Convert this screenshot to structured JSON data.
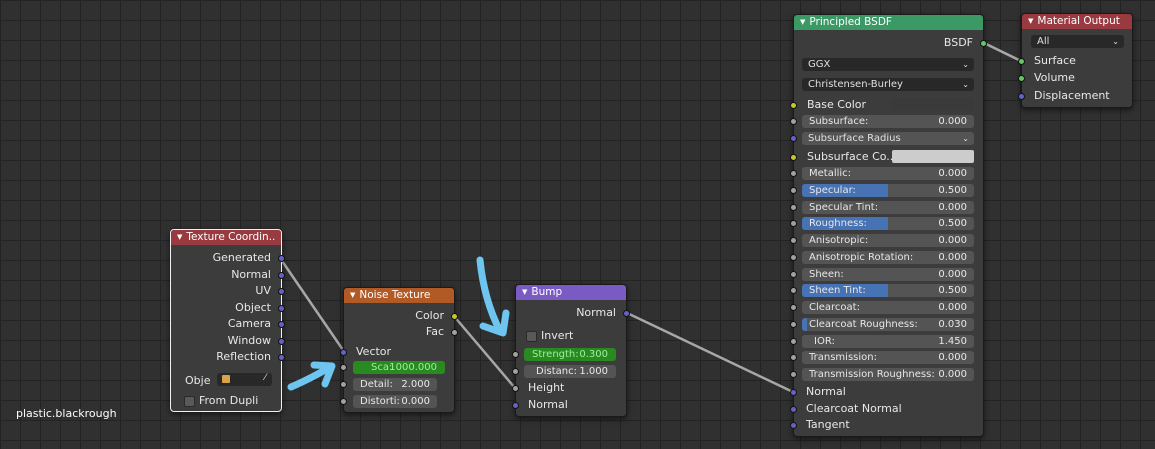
{
  "caption": "plastic.blackrough",
  "colors": {
    "header_red": "#983a3f",
    "header_orange": "#b25a26",
    "header_purple": "#7a5bc4",
    "header_green": "#3a9965",
    "socket_vector": "#6363c7",
    "socket_color": "#c7c729",
    "socket_float": "#a1a1a1",
    "socket_shader": "#63c763",
    "field_blue": "#4772b3",
    "field_green": "#2a8a22",
    "arrow": "#6ec6f0"
  },
  "texture_coordinate": {
    "title": "Texture Coordin..",
    "outputs": [
      "Generated",
      "Normal",
      "UV",
      "Object",
      "Camera",
      "Window",
      "Reflection"
    ],
    "object_label": "Obje",
    "from_dupli": "From Dupli"
  },
  "noise_texture": {
    "title": "Noise Texture",
    "outputs": [
      "Color",
      "Fac"
    ],
    "vector": "Vector",
    "scale": {
      "label": "Sca:",
      "value": "1000.000"
    },
    "detail": {
      "label": "Detail:",
      "value": "2.000"
    },
    "distortion": {
      "label": "Distorti:",
      "value": "0.000"
    }
  },
  "bump": {
    "title": "Bump",
    "output": "Normal",
    "invert": "Invert",
    "strength": {
      "label": "Strength:",
      "value": "0.300"
    },
    "distance": {
      "label": "Distanc:",
      "value": "1.000"
    },
    "height": "Height",
    "normal_in": "Normal"
  },
  "principled": {
    "title": "Principled BSDF",
    "output": "BSDF",
    "distribution": "GGX",
    "subsurface_method": "Christensen-Burley",
    "base_color": "Base Color",
    "subsurface": {
      "label": "Subsurface:",
      "value": "0.000"
    },
    "subsurface_radius": "Subsurface Radius",
    "subsurface_color": "Subsurface Co..",
    "fields": [
      {
        "label": "Metallic:",
        "value": "0.000",
        "fill": 0.0
      },
      {
        "label": "Specular:",
        "value": "0.500",
        "fill": 0.5
      },
      {
        "label": "Specular Tint:",
        "value": "0.000",
        "fill": 0.0
      },
      {
        "label": "Roughness:",
        "value": "0.500",
        "fill": 0.5
      },
      {
        "label": "Anisotropic:",
        "value": "0.000",
        "fill": 0.0
      },
      {
        "label": "Anisotropic Rotation:",
        "value": "0.000",
        "fill": 0.0
      },
      {
        "label": "Sheen:",
        "value": "0.000",
        "fill": 0.0
      },
      {
        "label": "Sheen Tint:",
        "value": "0.500",
        "fill": 0.5
      },
      {
        "label": "Clearcoat:",
        "value": "0.000",
        "fill": 0.0
      },
      {
        "label": "Clearcoat Roughness:",
        "value": "0.030",
        "fill": 0.03
      },
      {
        "label": "IOR:",
        "value": "1.450",
        "fill": 0.0
      },
      {
        "label": "Transmission:",
        "value": "0.000",
        "fill": 0.0
      },
      {
        "label": "Transmission Roughness:",
        "value": "0.000",
        "fill": 0.0
      }
    ],
    "normal": "Normal",
    "clearcoat_normal": "Clearcoat Normal",
    "tangent": "Tangent"
  },
  "material_output": {
    "title": "Material Output",
    "target": "All",
    "inputs": [
      "Surface",
      "Volume",
      "Displacement"
    ]
  }
}
